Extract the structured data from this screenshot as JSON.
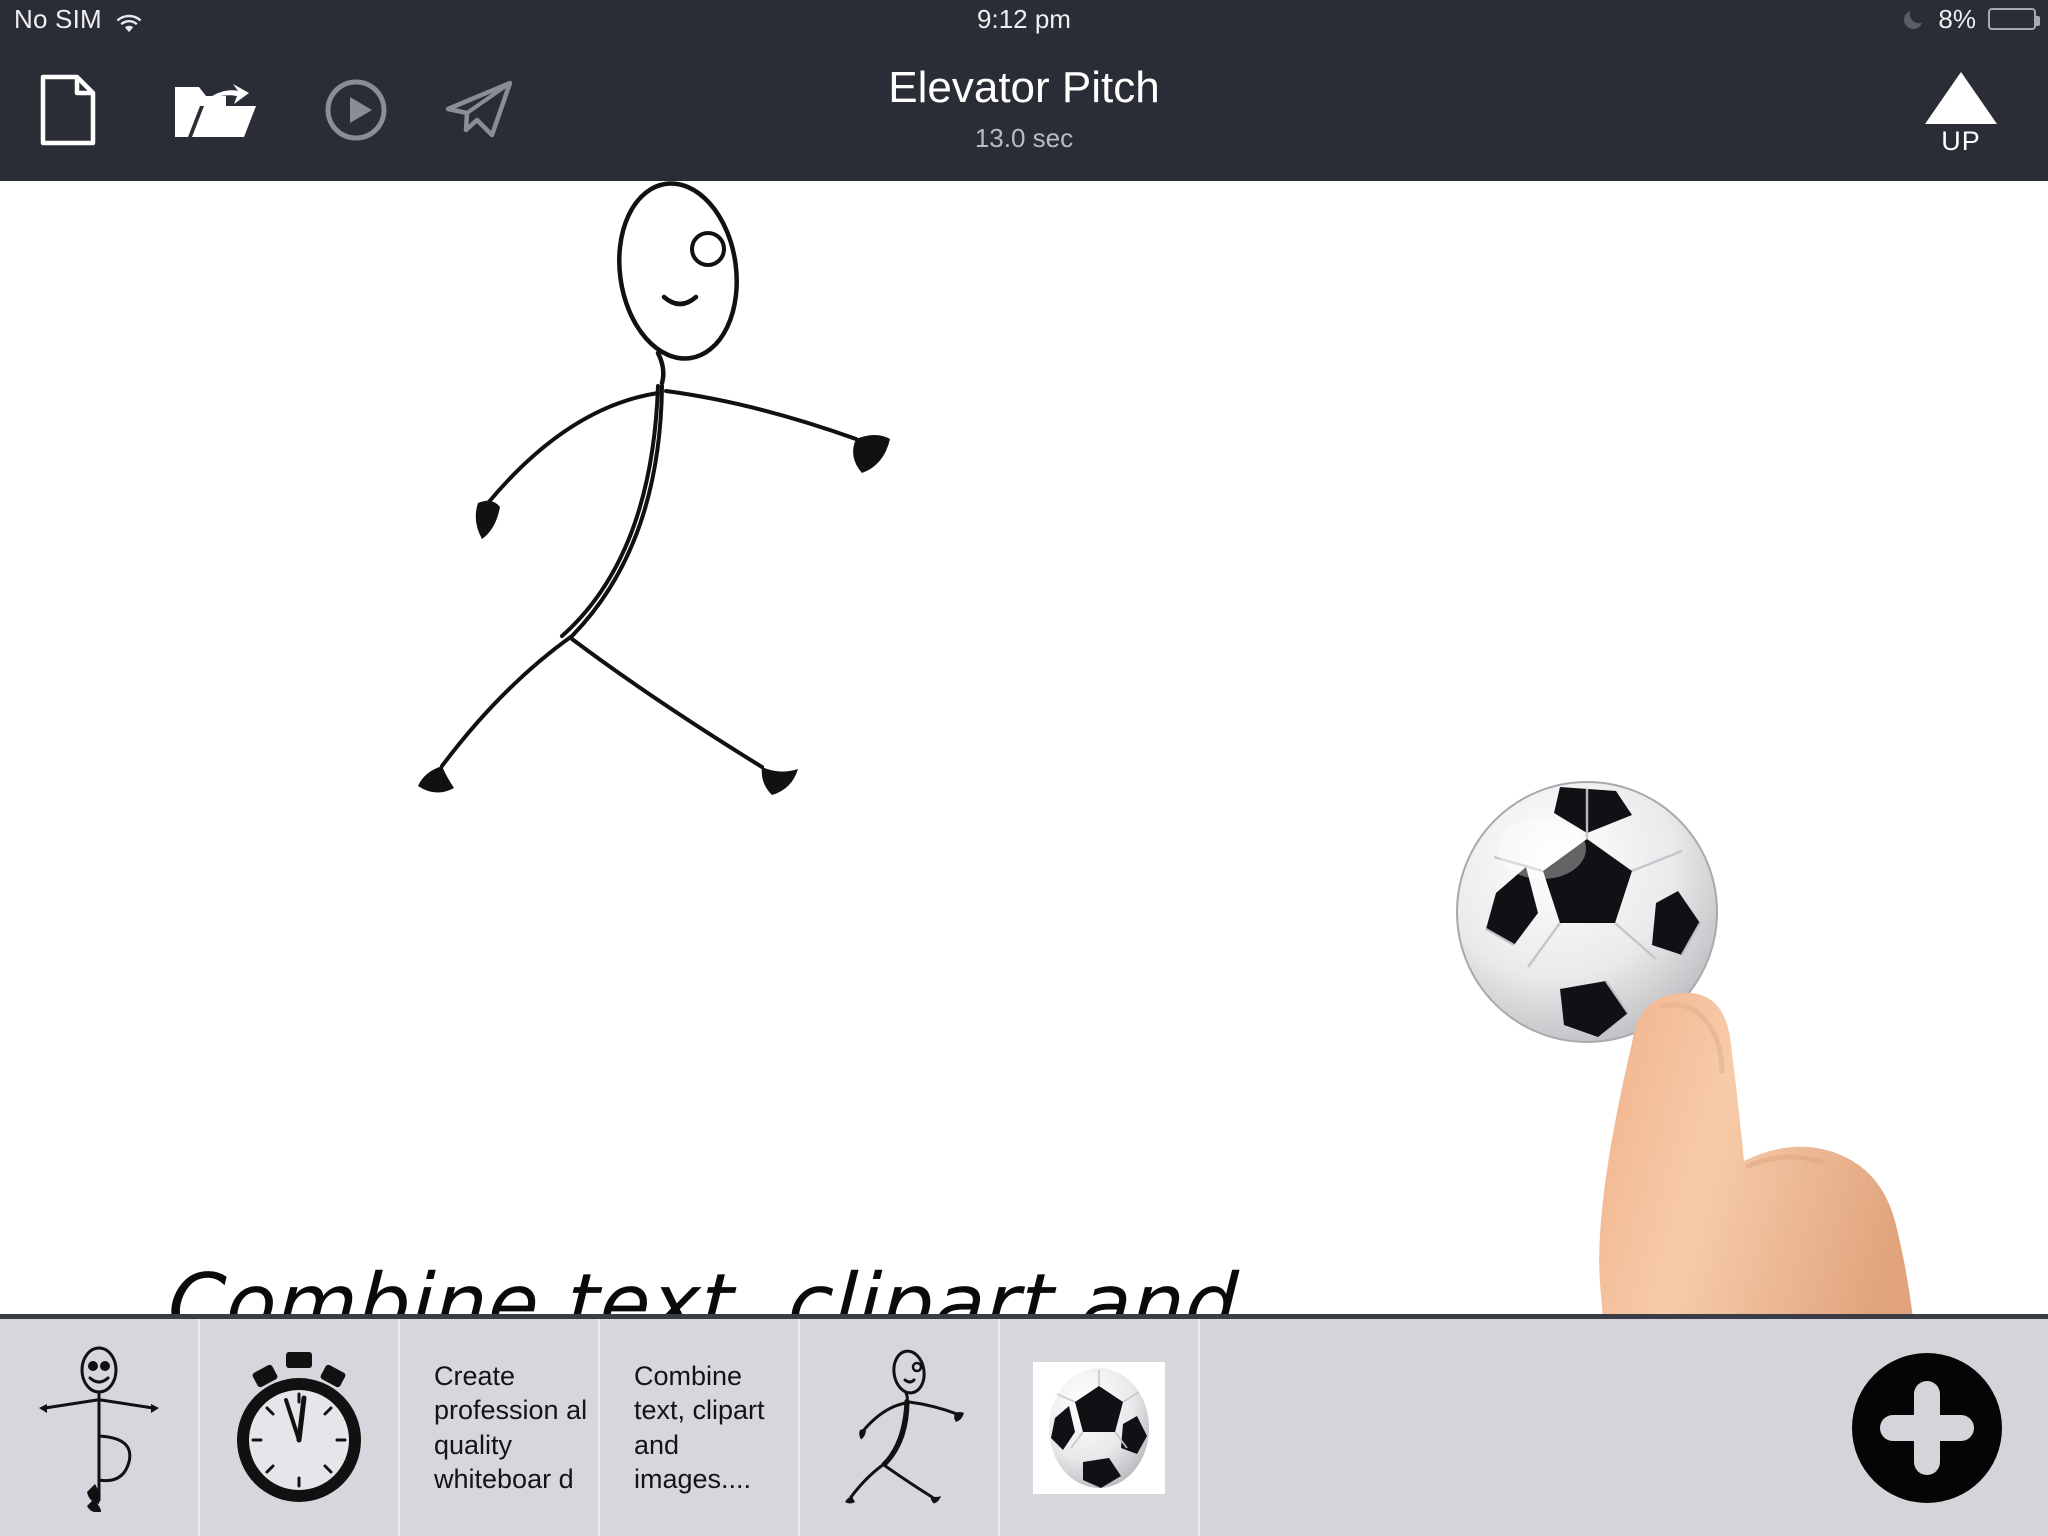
{
  "status_bar": {
    "carrier": "No SIM",
    "wifi_icon": "wifi-icon",
    "time": "9:12 pm",
    "moon_icon": "moon-icon",
    "battery_percent": "8%",
    "battery_level": 8,
    "battery_color": "#f4402c"
  },
  "toolbar": {
    "background": "#2a2d35",
    "new_icon": "new-document-icon",
    "open_icon": "open-folder-icon",
    "play_icon": "play-icon",
    "send_icon": "send-paper-plane-icon",
    "up_button": {
      "label": "UP",
      "icon": "triangle-up-icon"
    }
  },
  "header": {
    "title": "Elevator Pitch",
    "duration": "13.0 sec"
  },
  "canvas": {
    "background": "#ffffff",
    "handwritten_text": "Combine text, clipart and images....",
    "stick_figure": "running-stick-figure-drawing",
    "soccer_ball": "soccer-ball-image",
    "hand_pointer": "pointing-hand-image"
  },
  "filmstrip": {
    "background": "#d4d4da",
    "frames": [
      {
        "type": "drawing",
        "name": "dancing-stick-figure",
        "label": ""
      },
      {
        "type": "drawing",
        "name": "stopwatch",
        "label": ""
      },
      {
        "type": "text",
        "name": "text-frame",
        "label": "Create profession al quality whiteboar d"
      },
      {
        "type": "text",
        "name": "text-frame",
        "label": "Combine text, clipart and images...."
      },
      {
        "type": "drawing",
        "name": "running-stick-figure",
        "label": ""
      },
      {
        "type": "image",
        "name": "soccer-ball",
        "label": ""
      }
    ],
    "add_button": {
      "icon": "plus-icon",
      "label": "Add"
    }
  }
}
